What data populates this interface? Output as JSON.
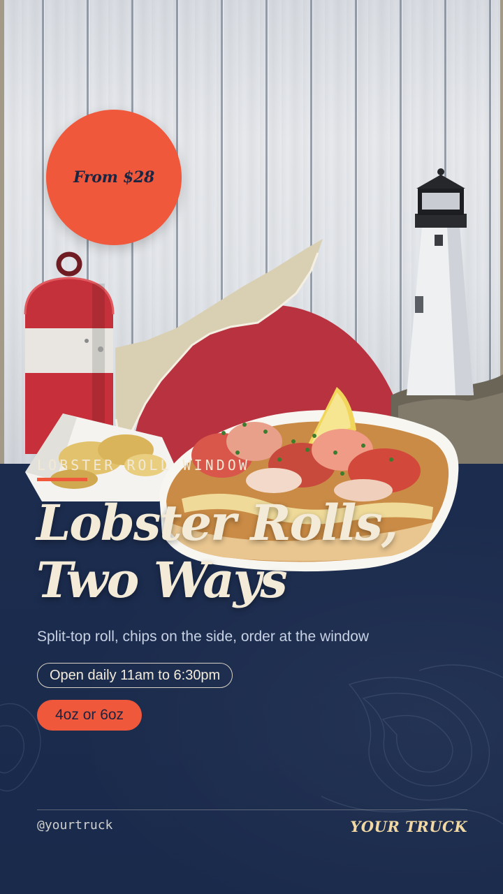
{
  "price_badge": {
    "text": "From $28"
  },
  "eyebrow": "LOBSTER ROLL WINDOW",
  "headline": {
    "line1": "Lobster Rolls,",
    "line2": "Two Ways"
  },
  "subtitle": "Split-top roll, chips on the side, order at the window",
  "hours": "Open daily 11am to 6:30pm",
  "sizes": "4oz or 6oz",
  "footer": {
    "handle": "@yourtruck",
    "brand": "YOUR TRUCK"
  },
  "colors": {
    "accent": "#f0583c",
    "navy": "#1b2b4d",
    "cream": "#f3ebd8",
    "brand_gold": "#f2d9a4"
  }
}
